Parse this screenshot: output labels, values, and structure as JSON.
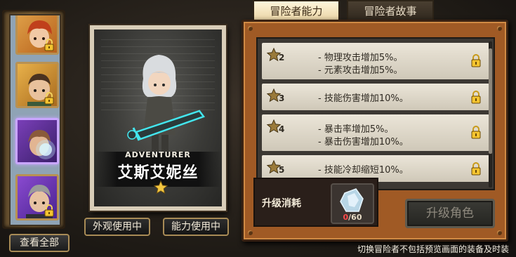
{
  "sidebar": {
    "view_all_label": "查看全部",
    "portraits": [
      {
        "locked": true,
        "selected": false
      },
      {
        "locked": true,
        "selected": false
      },
      {
        "locked": false,
        "selected": true
      },
      {
        "locked": true,
        "selected": false
      }
    ]
  },
  "card": {
    "class_label": "ADVENTURER",
    "character_name": "艾斯艾妮丝",
    "star_count": 1,
    "appearance_button": "外观使用中",
    "ability_button": "能力使用中"
  },
  "tabs": [
    {
      "label": "冒险者能力",
      "active": true
    },
    {
      "label": "冒险者故事",
      "active": false
    }
  ],
  "abilities": [
    {
      "stars": "2",
      "lines": [
        "- 物理攻击增加5%。",
        "- 元素攻击增加5%。"
      ],
      "locked": true
    },
    {
      "stars": "3",
      "lines": [
        "- 技能伤害增加10%。"
      ],
      "locked": true
    },
    {
      "stars": "4",
      "lines": [
        "- 暴击率增加5%。",
        "- 暴击伤害增加10%。"
      ],
      "locked": true
    },
    {
      "stars": "5",
      "lines": [
        "- 技能冷却缩短10%。"
      ],
      "locked": true
    }
  ],
  "upgrade": {
    "cost_label": "升级消耗",
    "owned": "0",
    "required": "/60",
    "button_label": "升级角色"
  },
  "footer": {
    "note": "切换冒险者不包括预览画面的装备及时装"
  },
  "colors": {
    "panel_wood": "#a05a25",
    "tab_active": "#e9d3a3",
    "selected_portrait": "#c9a6ff",
    "insufficient": "#ff4b4b"
  }
}
